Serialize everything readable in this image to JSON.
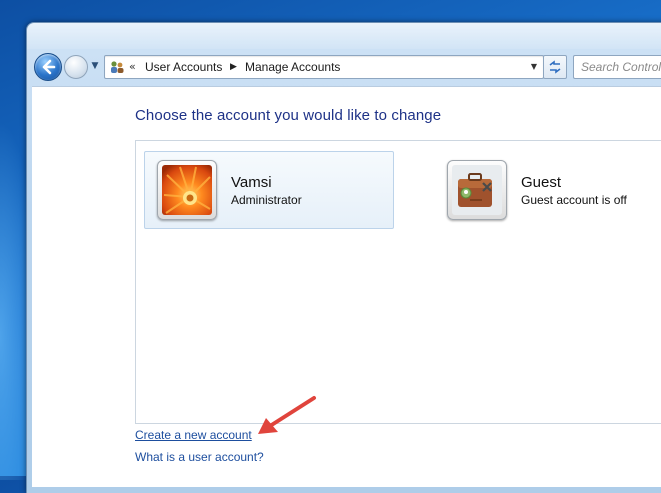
{
  "navigation": {
    "breadcrumb": [
      "User Accounts",
      "Manage Accounts"
    ],
    "search_placeholder": "Search Control"
  },
  "main": {
    "heading": "Choose the account you would like to change",
    "accounts": [
      {
        "name": "Vamsi",
        "subtitle": "Administrator",
        "icon": "flower-avatar-icon",
        "selected": true
      },
      {
        "name": "Guest",
        "subtitle": "Guest account is off",
        "icon": "briefcase-avatar-icon",
        "selected": false
      }
    ],
    "links": {
      "create_account": "Create a new account",
      "what_is_account": "What is a user account?"
    }
  },
  "colors": {
    "heading": "#1e3287",
    "link": "#1d4e9e",
    "annotation_arrow": "#e0443c"
  }
}
